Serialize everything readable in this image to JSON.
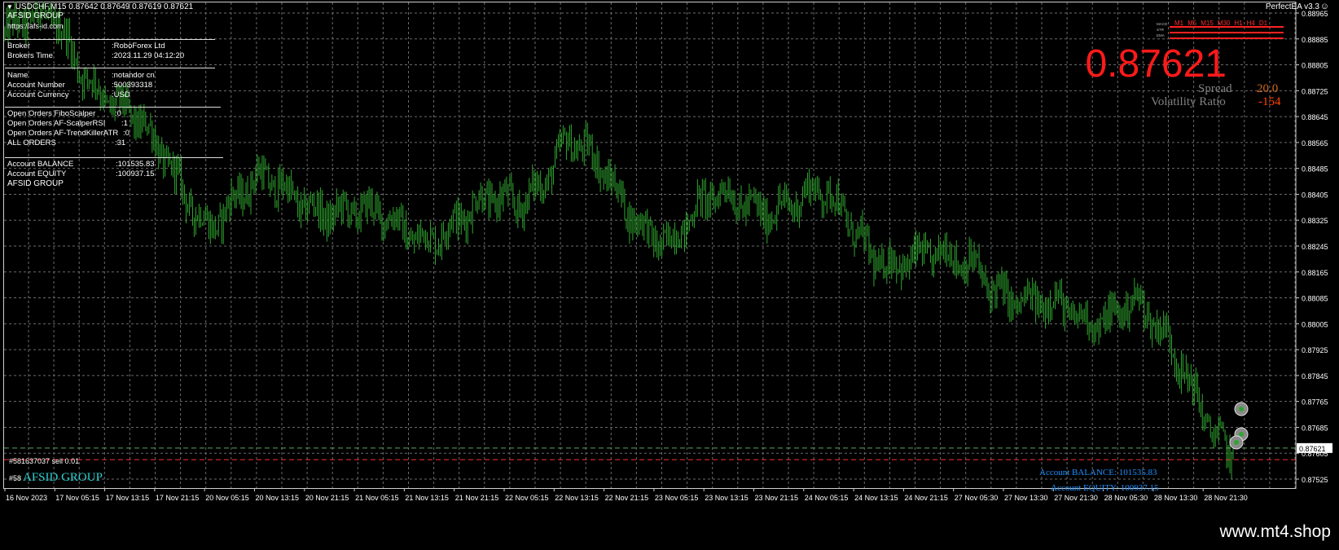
{
  "header": {
    "symbol_line": "USDCHF,M15  0.87642 0.87649 0.87619 0.87621",
    "ea_name": "PerfectEA  v3.3"
  },
  "info_panel": {
    "title": "AFSID GROUP",
    "url": "https://afs-id.com",
    "broker_label": "Broker",
    "broker_value": ":RoboForex Ltd",
    "broker_time_label": "Brokers Time",
    "broker_time_value": ":2023.11.29 04:12:20",
    "name_label": "Name",
    "name_value": ":notandor cn",
    "account_number_label": "Account Number",
    "account_number_value": ":500393318",
    "currency_label": "Account Currency",
    "currency_value": ":USD",
    "open_fibo_label": "Open Orders FiboScalper",
    "open_fibo_value": ":0",
    "open_rsi_label": "Open Orders AF-ScalperRSI",
    "open_rsi_value": ":1",
    "open_atr_label": "Open Orders AF-TrendKillerATR",
    "open_atr_value": ":0",
    "all_orders_label": "ALL ORDERS",
    "all_orders_value": ":31",
    "balance_label": "Account BALANCE",
    "balance_value": ":101535.83",
    "equity_label": "Account EQUITY",
    "equity_value": ":100937.15",
    "footer": "AFSID GROUP"
  },
  "right_panel": {
    "big_price": "0.87621",
    "spread_label": "Spread",
    "spread_value": "20.0",
    "volatility_label": "Volatility Ratio",
    "volatility_value": "-154",
    "timeframes": [
      "M1",
      "M5",
      "M15",
      "M30",
      "H1",
      "H4",
      "D1"
    ],
    "indicator_names": [
      "MACD",
      "STR",
      "EMA"
    ],
    "balance_text": "Account BALANCE: 101535.83",
    "equity_text": "Account EQUITY: 100937.15"
  },
  "orders": {
    "order1": "#581637037 sell 0.01",
    "order2": "#58",
    "afsid_overlay": "AFSID GROUP"
  },
  "price_axis": {
    "labels": [
      "0.88965",
      "0.88885",
      "0.88805",
      "0.88725",
      "0.88645",
      "0.88565",
      "0.88485",
      "0.88405",
      "0.88325",
      "0.88245",
      "0.88165",
      "0.88085",
      "0.88005",
      "0.87925",
      "0.87845",
      "0.87765",
      "0.87685",
      "0.87605",
      "0.87525"
    ],
    "current": "0.87621"
  },
  "time_axis": {
    "labels": [
      "16 Nov 2023",
      "17 Nov 05:15",
      "17 Nov 13:15",
      "17 Nov 21:15",
      "20 Nov 05:15",
      "20 Nov 13:15",
      "20 Nov 21:15",
      "21 Nov 05:15",
      "21 Nov 13:15",
      "21 Nov 21:15",
      "22 Nov 05:15",
      "22 Nov 13:15",
      "22 Nov 21:15",
      "23 Nov 05:15",
      "23 Nov 13:15",
      "23 Nov 21:15",
      "24 Nov 05:15",
      "24 Nov 13:15",
      "24 Nov 21:15",
      "27 Nov 05:30",
      "27 Nov 13:30",
      "27 Nov 21:30",
      "28 Nov 05:30",
      "28 Nov 13:30",
      "28 Nov 21:30"
    ]
  },
  "watermark": "www.mt4.shop",
  "colors": {
    "background": "#000000",
    "grid": "#6b6b6b",
    "bars": "#2fa52f",
    "price_red": "#ff1a1a",
    "spread_value": "#d2691e",
    "volatility_value": "#ff4500",
    "account_blue": "#1e90ff"
  },
  "chart_data": {
    "type": "line",
    "symbol": "USDCHF",
    "timeframe": "M15",
    "x": [
      "16 Nov 2023",
      "17 Nov 05:15",
      "17 Nov 13:15",
      "17 Nov 21:15",
      "20 Nov 05:15",
      "20 Nov 13:15",
      "20 Nov 21:15",
      "21 Nov 05:15",
      "21 Nov 13:15",
      "21 Nov 21:15",
      "22 Nov 05:15",
      "22 Nov 13:15",
      "22 Nov 21:15",
      "23 Nov 05:15",
      "23 Nov 13:15",
      "23 Nov 21:15",
      "24 Nov 05:15",
      "24 Nov 13:15",
      "24 Nov 21:15",
      "27 Nov 05:30",
      "27 Nov 13:30",
      "27 Nov 21:30",
      "28 Nov 05:30",
      "28 Nov 13:30",
      "28 Nov 21:30"
    ],
    "series": [
      {
        "values": [
          0.889,
          0.8893,
          0.8872,
          0.8852,
          0.8834,
          0.8842,
          0.884,
          0.8832,
          0.883,
          0.8833,
          0.8838,
          0.8858,
          0.8838,
          0.8828,
          0.8838,
          0.8839,
          0.8838,
          0.8824,
          0.8818,
          0.882,
          0.8805,
          0.8802,
          0.8809,
          0.8785,
          0.8762
        ]
      }
    ],
    "ylim": [
      0.87525,
      0.88965
    ],
    "grid": true,
    "order_levels": [
      0.87621,
      0.87585
    ],
    "current_price": 0.87621
  }
}
